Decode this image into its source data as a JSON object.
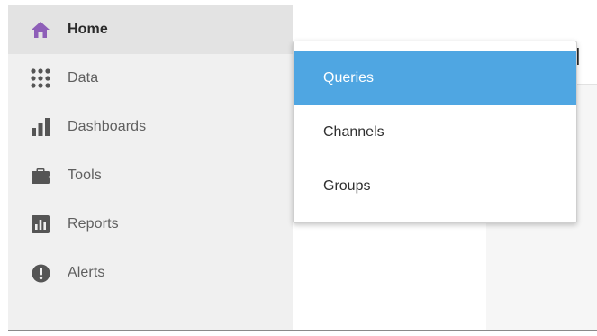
{
  "sidebar": {
    "items": [
      {
        "label": "Home",
        "icon": "home-icon",
        "active": true
      },
      {
        "label": "Data",
        "icon": "dots-grid-icon"
      },
      {
        "label": "Dashboards",
        "icon": "bar-chart-icon"
      },
      {
        "label": "Tools",
        "icon": "briefcase-icon"
      },
      {
        "label": "Reports",
        "icon": "report-chart-icon"
      },
      {
        "label": "Alerts",
        "icon": "alert-icon"
      }
    ]
  },
  "main": {
    "title_fragment": "d"
  },
  "menu": {
    "items": [
      {
        "label": "Queries",
        "selected": true
      },
      {
        "label": "Channels"
      },
      {
        "label": "Groups"
      }
    ]
  },
  "colors": {
    "home_icon": "#8e5fb8",
    "icon_gray": "#555555",
    "selected_bg": "#4fa6e2",
    "sidebar_bg": "#f0f0f0",
    "active_bg": "#e3e3e3"
  }
}
